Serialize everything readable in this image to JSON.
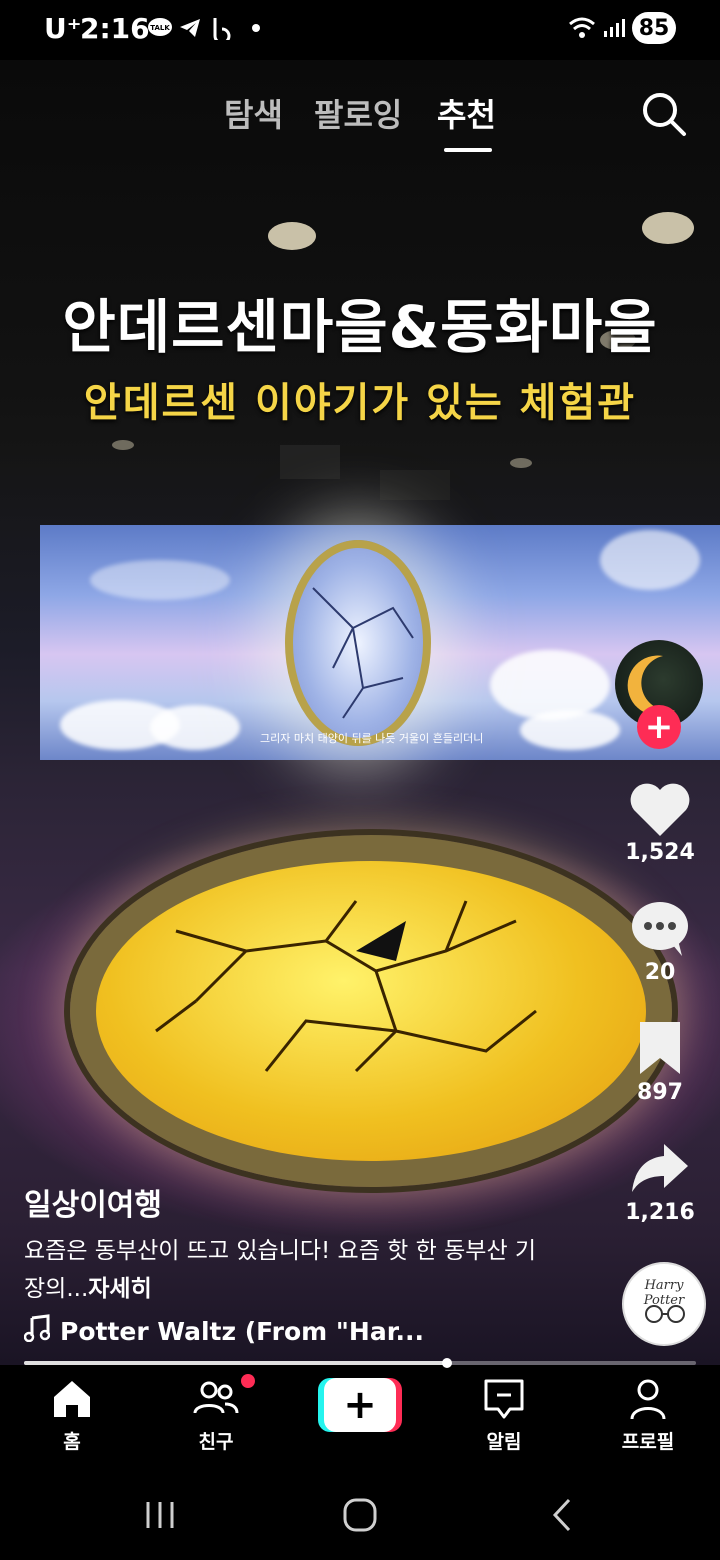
{
  "status_bar": {
    "carrier": "U⁺",
    "time": "2:16",
    "notification_icons": [
      "talk-icon",
      "telegram-icon",
      "b-app-icon",
      "dot-icon"
    ],
    "battery": "85"
  },
  "top_tabs": [
    {
      "label": "탐색",
      "active": false
    },
    {
      "label": "팔로잉",
      "active": false
    },
    {
      "label": "추천",
      "active": true
    }
  ],
  "video": {
    "title_line1": "안데르센마을&동화마을",
    "title_line2": "안데르센 이야기가 있는 체험관",
    "screen_caption": "그리자 마치 태양이 뒤를 나듯 거울이 흔들리더니",
    "progress": 0.63
  },
  "right_rail": {
    "likes": "1,524",
    "comments": "20",
    "saves": "897",
    "shares": "1,216",
    "music_disc_text": "Harry Potter"
  },
  "post": {
    "username": "일상이여행",
    "description": "요즘은 동부산이 뜨고 있습니다! 요즘 핫 한 동부산 기장의...",
    "more_label": "자세히",
    "music": "Potter Waltz (From \"Har..."
  },
  "bottom_nav": [
    {
      "label": "홈",
      "icon": "home-icon"
    },
    {
      "label": "친구",
      "icon": "friends-icon"
    },
    {
      "label": "",
      "icon": "create-icon"
    },
    {
      "label": "알림",
      "icon": "inbox-icon"
    },
    {
      "label": "프로필",
      "icon": "profile-icon"
    }
  ],
  "colors": {
    "accent": "#fe2c55",
    "cyan": "#25f4ee",
    "title_yellow": "#f5d547"
  }
}
